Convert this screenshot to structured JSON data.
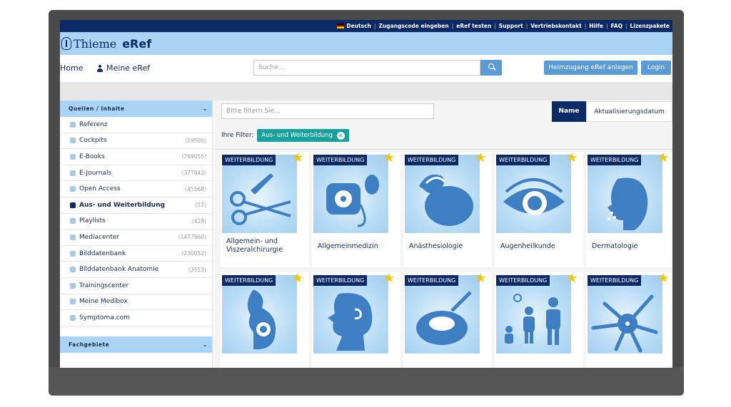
{
  "topbar": {
    "language": "Deutsch",
    "links": [
      "Zugangscode eingeben",
      "eRef testen",
      "Support",
      "Vertriebskontakt",
      "Hilfe",
      "FAQ",
      "Lizenzpakete"
    ]
  },
  "brand": {
    "name": "Thieme",
    "product": "eRef"
  },
  "nav": {
    "home": "Home",
    "meine": "Meine eRef",
    "search_placeholder": "Suche...",
    "heimzugang": "Heimzugang eRef anlegen",
    "login": "Login"
  },
  "sidebar": {
    "section1": "Quellen / Inhalte",
    "items": [
      {
        "label": "Referenz",
        "count": ""
      },
      {
        "label": "Cockpits",
        "count": "(19505)"
      },
      {
        "label": "E-Books",
        "count": "(769055)"
      },
      {
        "label": "E-Journals",
        "count": "(377843)"
      },
      {
        "label": "Open Access",
        "count": "(45568)"
      },
      {
        "label": "Aus- und Weiterbildung",
        "count": "(17)"
      },
      {
        "label": "Playlists",
        "count": "(428)"
      },
      {
        "label": "Mediacenter",
        "count": "(1477960)"
      },
      {
        "label": "Bilddatenbank",
        "count": "(230052)"
      },
      {
        "label": "Bilddatenbank Anatomie",
        "count": "(3553)"
      },
      {
        "label": "Trainingscenter",
        "count": ""
      },
      {
        "label": "Meine Medibox",
        "count": ""
      },
      {
        "label": "Symptoma.com",
        "count": ""
      }
    ],
    "section2": "Fachgebiete"
  },
  "main": {
    "filter_placeholder": "Bitte filtern Sie...",
    "sort_name": "Name",
    "sort_date": "Aktualisierungsdatum",
    "filter_label": "Ihre Filter:",
    "active_filter": "Aus- und Weiterbildung",
    "badge": "WEITERBILDUNG",
    "cards": [
      {
        "title": "Allgemein- und Viszeralchirurgie",
        "icon": "scissors-scalpel-icon"
      },
      {
        "title": "Allgemeinmedizin",
        "icon": "blood-pressure-icon"
      },
      {
        "title": "Anästhesiologie",
        "icon": "anesthesia-mask-icon"
      },
      {
        "title": "Augenheilkunde",
        "icon": "eye-icon"
      },
      {
        "title": "Dermatologie",
        "icon": "face-profile-icon"
      },
      {
        "title": "",
        "icon": "pregnancy-icon"
      },
      {
        "title": "",
        "icon": "ear-throat-icon"
      },
      {
        "title": "",
        "icon": "petri-dish-icon"
      },
      {
        "title": "",
        "icon": "family-icon"
      },
      {
        "title": "",
        "icon": "neuron-icon"
      }
    ]
  }
}
